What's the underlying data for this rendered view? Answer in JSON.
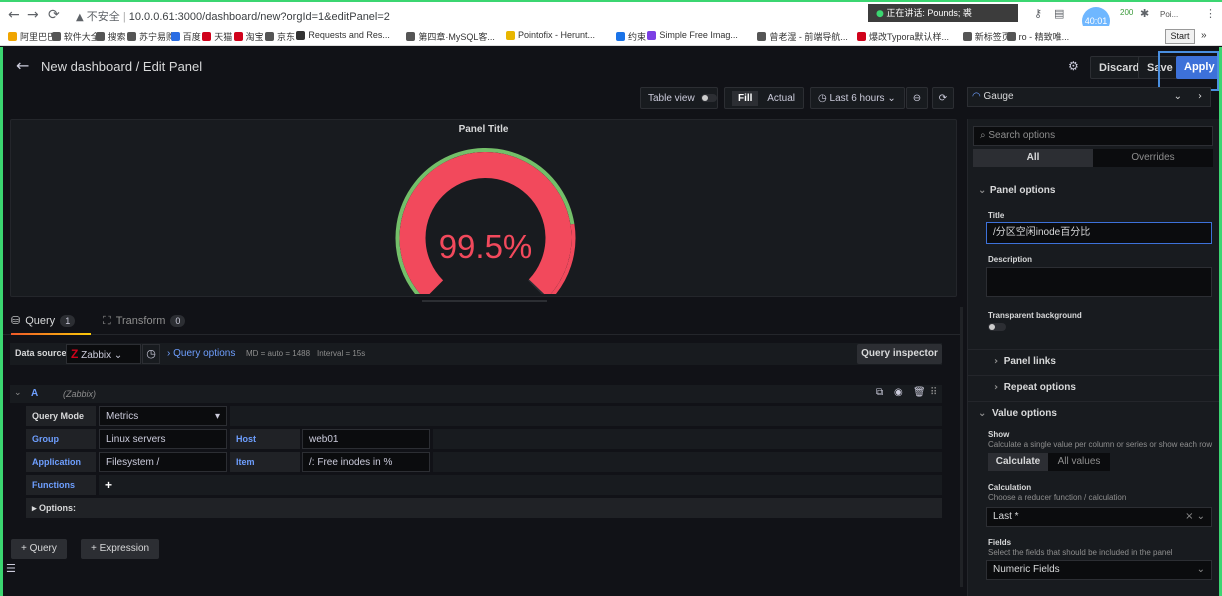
{
  "browser": {
    "url_warning": "不安全",
    "url": "10.0.0.61:3000/dashboard/new?orgId=1&editPanel=2",
    "speaking_indicator": "正在讲话: Pounds; 裘",
    "ext_count": "200",
    "ext_label": "Poi...",
    "start_label": "Start",
    "timer_badge": "40:01",
    "bookmarks": [
      "阿里巴巴",
      "软件大全",
      "搜索",
      "苏宁易购",
      "百度",
      "天猫",
      "淘宝",
      "京东",
      "Requests and Res...",
      "第四章·MySQL客...",
      "Pointofix - Herunt...",
      "约束",
      "Simple Free Imag...",
      "曾老湿 - 前端导航...",
      "爆改Typora默认样...",
      "新标签页",
      "ro - 精致唯..."
    ],
    "bookmarks_more": "»"
  },
  "header": {
    "title": "New dashboard / Edit Panel",
    "discard_label": "Discard",
    "save_label": "Save",
    "apply_label": "Apply"
  },
  "toolbar": {
    "table_view_label": "Table view",
    "fill_label": "Fill",
    "actual_label": "Actual",
    "time_range_label": "Last 6 hours"
  },
  "panel": {
    "title": "Panel Title",
    "gauge_value": "99.5%",
    "gauge_percent": 99.5
  },
  "colors": {
    "accent": "#3d71d9",
    "gauge_red": "#f2495c",
    "gauge_green": "#73bf69"
  },
  "query_tabs": [
    {
      "label": "Query",
      "count": "1"
    },
    {
      "label": "Transform",
      "count": "0"
    }
  ],
  "datasource": {
    "label": "Data source",
    "name": "Zabbix",
    "query_options_label": "Query options",
    "md_text": "MD = auto = 1488",
    "interval_text": "Interval = 15s",
    "query_inspector_label": "Query inspector"
  },
  "query_a": {
    "ref": "A",
    "ds_tag": "(Zabbix)",
    "query_mode_label": "Query Mode",
    "query_mode_value": "Metrics",
    "group_label": "Group",
    "group_value": "Linux servers",
    "host_label": "Host",
    "host_value": "web01",
    "application_label": "Application",
    "application_value": "Filesystem /",
    "item_label": "Item",
    "item_value": "/: Free inodes in %",
    "functions_label": "Functions",
    "options_label": "▸ Options:"
  },
  "bottom": {
    "add_query_label": "+ Query",
    "add_expression_label": "+ Expression"
  },
  "options_pane": {
    "viz_name": "Gauge",
    "search_placeholder": "Search options",
    "tab_all": "All",
    "tab_overrides": "Overrides",
    "panel_options": "Panel options",
    "title_label": "Title",
    "title_value": "/分区空闲inode百分比",
    "description_label": "Description",
    "transparent_label": "Transparent background",
    "panel_links": "Panel links",
    "repeat_options": "Repeat options",
    "value_options": "Value options",
    "show_label": "Show",
    "show_desc": "Calculate a single value per column or series or show each row",
    "calculate_label": "Calculate",
    "all_values_label": "All values",
    "calculation_label": "Calculation",
    "calculation_desc": "Choose a reducer function / calculation",
    "calculation_value": "Last *",
    "fields_label": "Fields",
    "fields_desc": "Select the fields that should be included in the panel",
    "fields_value": "Numeric Fields"
  }
}
